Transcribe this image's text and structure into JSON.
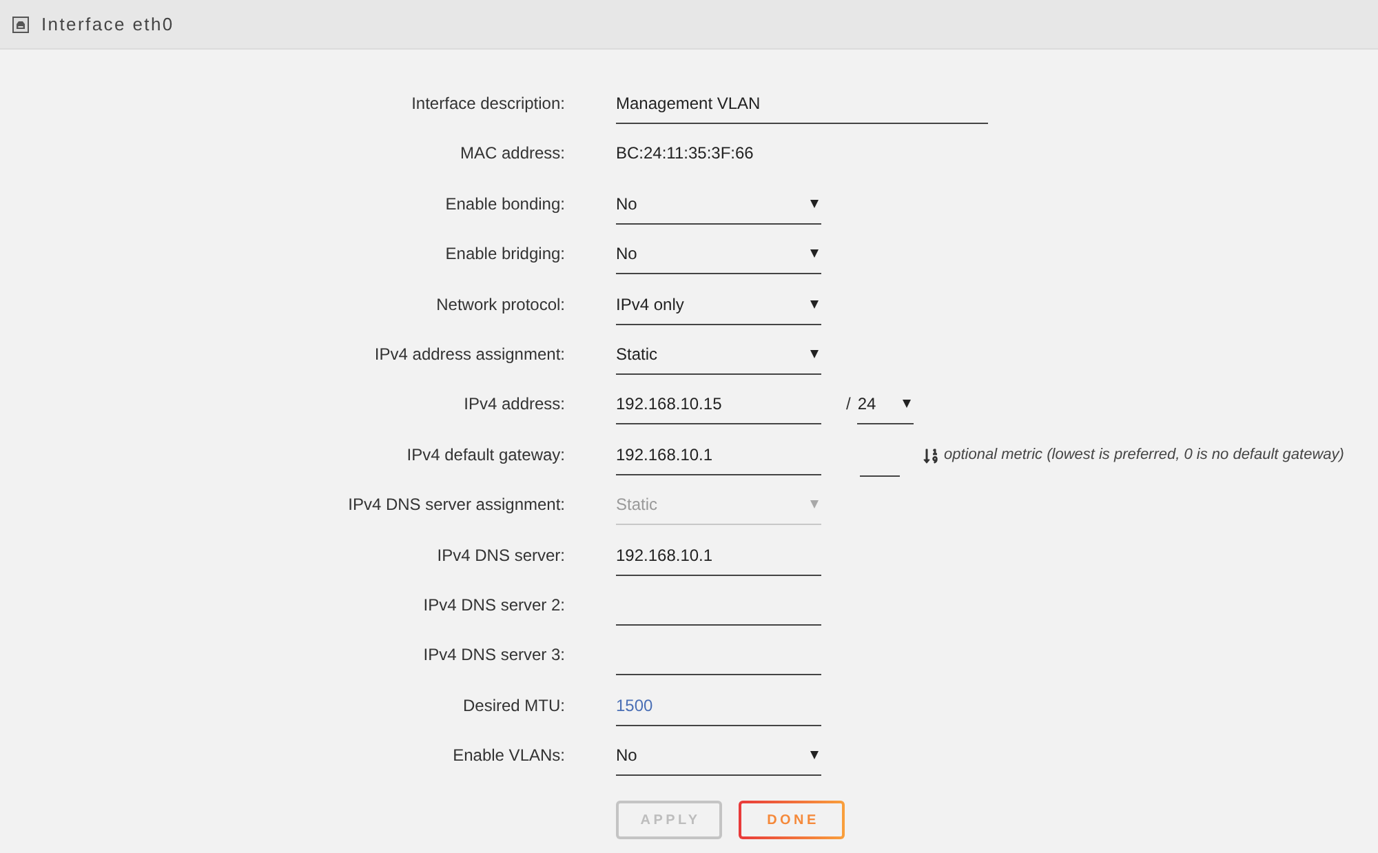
{
  "window": {
    "title": "Interface eth0"
  },
  "form": {
    "fields": [
      {
        "kind": "text",
        "label": "Interface description:",
        "value": "Management VLAN"
      },
      {
        "kind": "static",
        "label": "MAC address:",
        "value": "BC:24:11:35:3F:66"
      },
      {
        "kind": "select",
        "label": "Enable bonding:",
        "value": "No",
        "disabled": false
      },
      {
        "kind": "select",
        "label": "Enable bridging:",
        "value": "No",
        "disabled": false
      },
      {
        "kind": "select",
        "label": "Network protocol:",
        "value": "IPv4 only",
        "disabled": false
      },
      {
        "kind": "select",
        "label": "IPv4 address assignment:",
        "value": "Static",
        "disabled": false
      },
      {
        "kind": "text",
        "label": "IPv4 address:",
        "value": "192.168.10.15",
        "prefix": {
          "separator": "/",
          "value": "24"
        }
      },
      {
        "kind": "text",
        "label": "IPv4 default gateway:",
        "value": "192.168.10.1",
        "metric": {
          "hint": "optional metric (lowest is preferred, 0 is no default gateway)"
        }
      },
      {
        "kind": "select",
        "label": "IPv4 DNS server assignment:",
        "value": "Static",
        "disabled": true
      },
      {
        "kind": "text",
        "label": "IPv4 DNS server:",
        "value": "192.168.10.1"
      },
      {
        "kind": "text",
        "label": "IPv4 DNS server 2:"
      },
      {
        "kind": "text",
        "label": "IPv4 DNS server 3:"
      },
      {
        "kind": "text",
        "label": "Desired MTU:",
        "placeholder": "1500"
      },
      {
        "kind": "select",
        "label": "Enable VLANs:",
        "value": "No",
        "disabled": false
      }
    ]
  },
  "buttons": [
    {
      "label": "APPLY",
      "kind": "secondary",
      "disabled": true
    },
    {
      "label": "DONE",
      "kind": "primary",
      "disabled": false
    }
  ]
}
